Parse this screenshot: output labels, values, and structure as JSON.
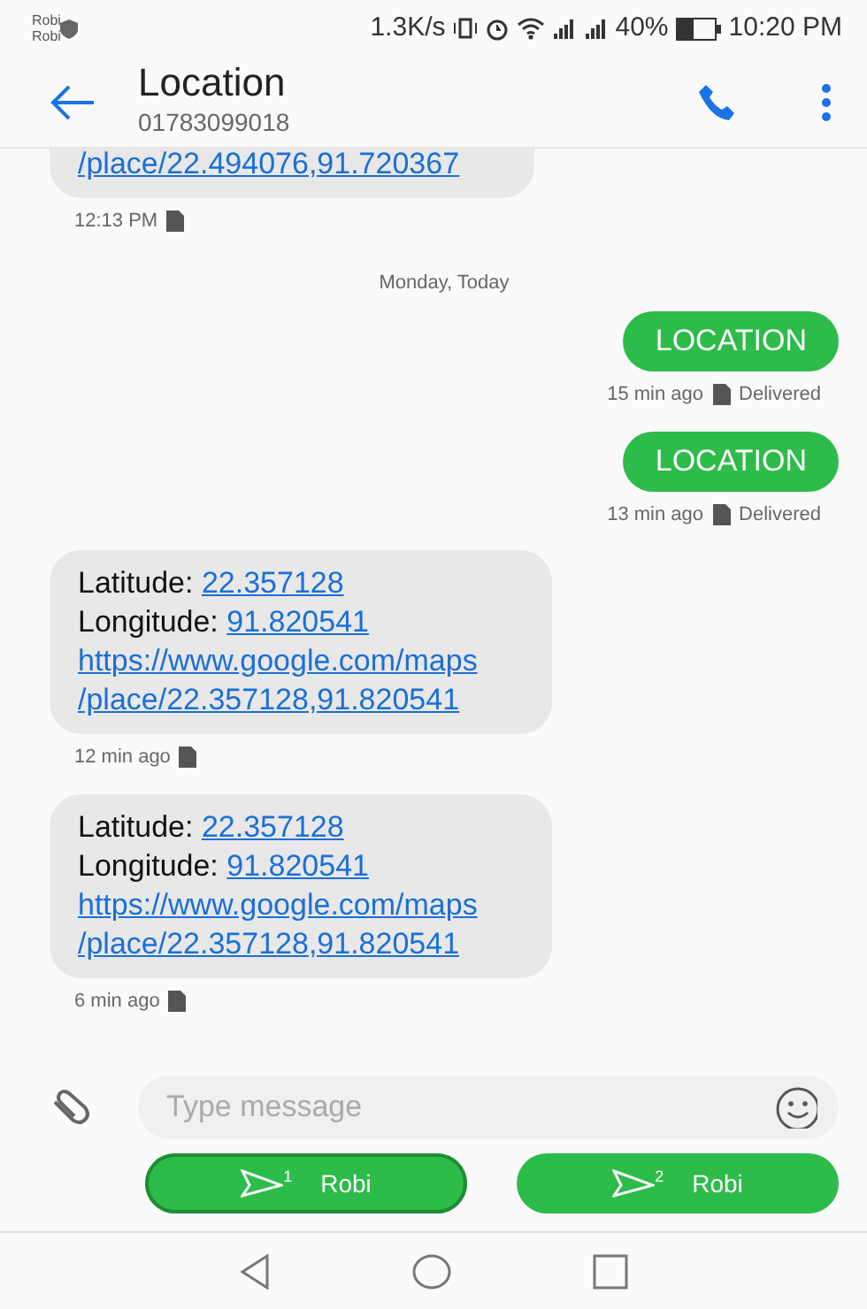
{
  "status_bar": {
    "carriers": [
      "Robi",
      "Robi"
    ],
    "speed": "1.3K/s",
    "battery": "40%",
    "time": "10:20 PM"
  },
  "header": {
    "title": "Location",
    "subtitle": "01783099018"
  },
  "messages": [
    {
      "kind": "incoming",
      "lines": [
        [
          {
            "text": "/place/22.494076,91.720367",
            "link": true
          }
        ]
      ],
      "meta": "12:13 PM"
    },
    {
      "kind": "date",
      "text": "Monday, Today"
    },
    {
      "kind": "outgoing",
      "text": "LOCATION",
      "meta": "15 min ago",
      "status": "Delivered"
    },
    {
      "kind": "outgoing",
      "text": "LOCATION",
      "meta": "13 min ago",
      "status": "Delivered"
    },
    {
      "kind": "incoming",
      "lines": [
        [
          {
            "text": "Latitude: ",
            "link": false
          },
          {
            "text": "22.357128",
            "link": true
          }
        ],
        [
          {
            "text": "Longitude: ",
            "link": false
          },
          {
            "text": "91.820541",
            "link": true
          }
        ],
        [
          {
            "text": "https://www.google.com/maps",
            "link": true
          }
        ],
        [
          {
            "text": "/place/22.357128,91.820541",
            "link": true
          }
        ]
      ],
      "meta": "12 min ago"
    },
    {
      "kind": "incoming",
      "lines": [
        [
          {
            "text": "Latitude: ",
            "link": false
          },
          {
            "text": "22.357128",
            "link": true
          }
        ],
        [
          {
            "text": "Longitude: ",
            "link": false
          },
          {
            "text": "91.820541",
            "link": true
          }
        ],
        [
          {
            "text": "https://www.google.com/maps",
            "link": true
          }
        ],
        [
          {
            "text": "/place/22.357128,91.820541",
            "link": true
          }
        ]
      ],
      "meta": "6 min ago"
    }
  ],
  "composer": {
    "placeholder": "Type message"
  },
  "send_buttons": [
    {
      "sim": "1",
      "label": "Robi",
      "selected": true
    },
    {
      "sim": "2",
      "label": "Robi",
      "selected": false
    }
  ]
}
